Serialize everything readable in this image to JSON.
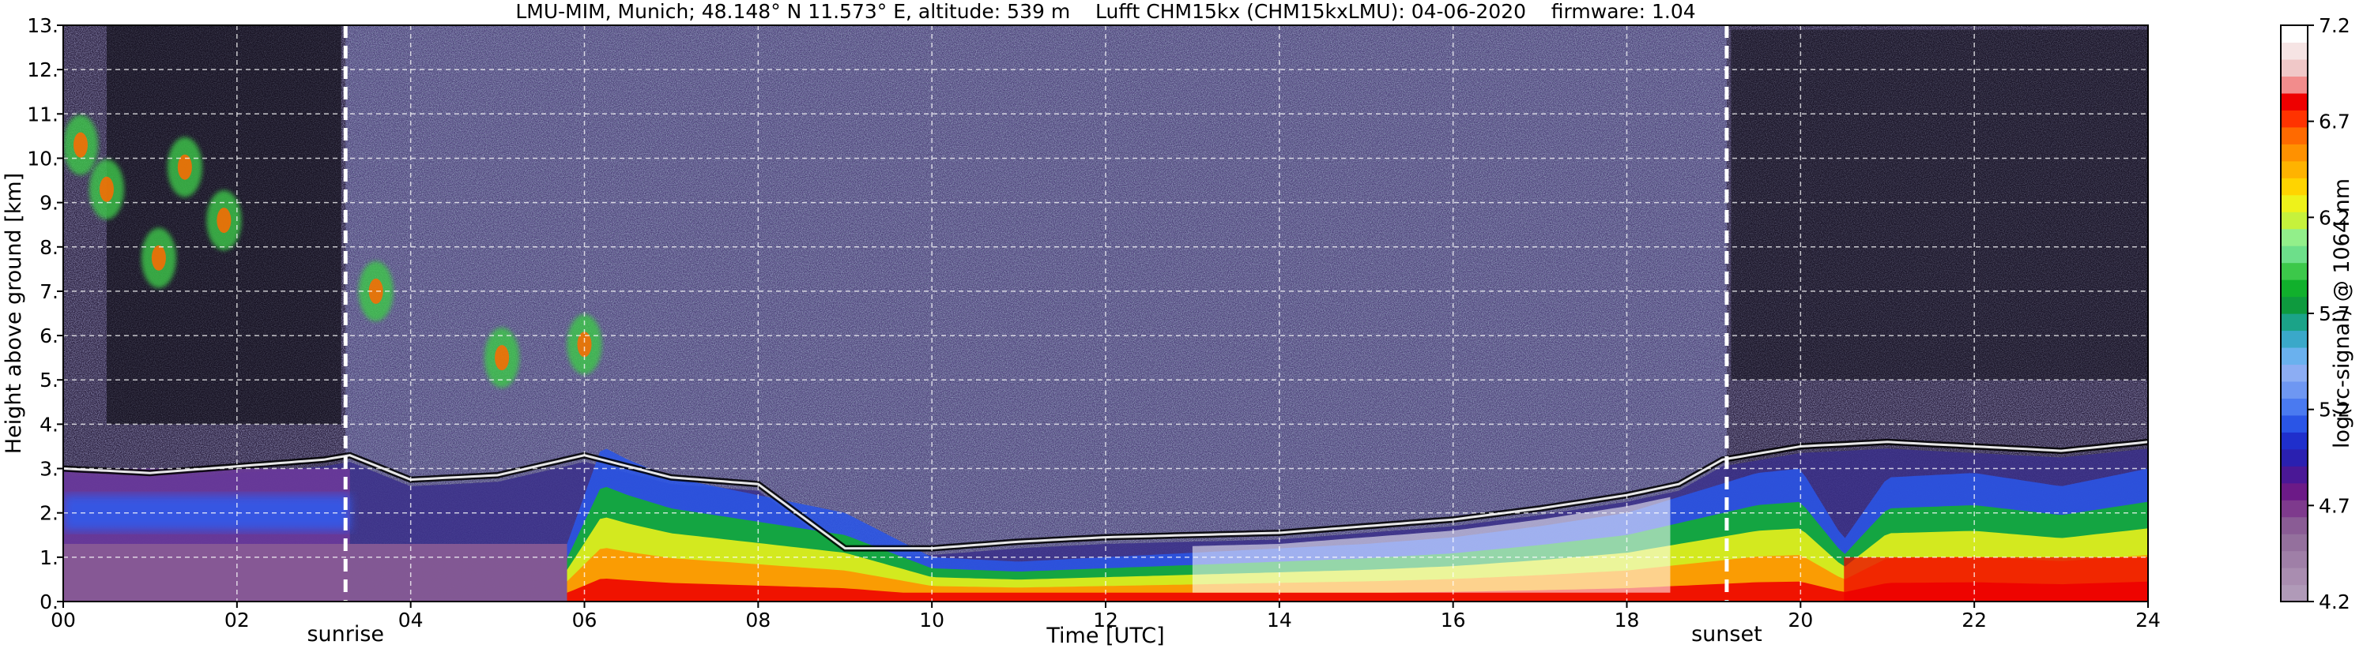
{
  "chart_data": {
    "type": "heatmap",
    "title": "LMU-MIM, Munich; 48.148° N 11.573° E, altitude: 539 m    Lufft CHM15kx (CHM15kxLMU): 04-06-2020    firmware: 1.04",
    "xlabel": "Time [UTC]",
    "ylabel": "Height above ground [km]",
    "xlim": [
      0,
      24
    ],
    "ylim": [
      0,
      13
    ],
    "x_ticks": [
      "00",
      "02",
      "04",
      "06",
      "08",
      "10",
      "12",
      "14",
      "16",
      "18",
      "20",
      "22",
      "24"
    ],
    "y_ticks": [
      "0.",
      "1.",
      "2.",
      "3.",
      "4.",
      "5.",
      "6.",
      "7.",
      "8.",
      "9.",
      "10.",
      "11.",
      "12.",
      "13."
    ],
    "grid": true,
    "events": [
      {
        "label": "sunrise",
        "time": 3.25
      },
      {
        "label": "sunset",
        "time": 19.15
      }
    ],
    "colorbar": {
      "label": "log(rc-signal) @ 1064 nm",
      "min": 4.2,
      "max": 7.2,
      "ticks": [
        "4.2",
        "4.7",
        "5.2",
        "5.7",
        "6.2",
        "6.7",
        "7.2"
      ],
      "colors": [
        "#b09ab8",
        "#a98db0",
        "#9f7fa7",
        "#94709d",
        "#8a5c95",
        "#7e3a8d",
        "#6c1a87",
        "#4a1896",
        "#2a20b0",
        "#1f2fcc",
        "#2a55e6",
        "#4a7af0",
        "#6e97f2",
        "#8cadf3",
        "#6ab1ee",
        "#3aa8c9",
        "#1ba388",
        "#0e9a3e",
        "#11b02c",
        "#3cc84a",
        "#6ddf8a",
        "#92ef8a",
        "#c6f23c",
        "#eef21a",
        "#ffd400",
        "#ffb300",
        "#ff9100",
        "#ff6a00",
        "#ff3300",
        "#ee0000",
        "#f28c8c",
        "#f0c8c8",
        "#f6e4e4",
        "#ffffff"
      ]
    },
    "layers": [
      {
        "name": "boundary_layer_top_km",
        "x": [
          0,
          1,
          2,
          3,
          3.3,
          4,
          5,
          6,
          7,
          8,
          9,
          10,
          11,
          12,
          13,
          14,
          15,
          16,
          17,
          18,
          18.6,
          19.1,
          20,
          21,
          22,
          23,
          24
        ],
        "y": [
          3.0,
          2.9,
          3.05,
          3.2,
          3.3,
          2.75,
          2.85,
          3.3,
          2.8,
          2.65,
          1.2,
          1.2,
          1.35,
          1.45,
          1.5,
          1.55,
          1.7,
          1.85,
          2.1,
          2.4,
          2.65,
          3.2,
          3.5,
          3.6,
          3.5,
          3.4,
          3.6
        ]
      },
      {
        "name": "aerosol_strong_top_km",
        "x": [
          0,
          1,
          2,
          3,
          4,
          5,
          5.8,
          6.2,
          6.5,
          7,
          7.5,
          8,
          8.5,
          9,
          10,
          11,
          12,
          13,
          14,
          15,
          16,
          17,
          18,
          19,
          19.5,
          20,
          20.5,
          21,
          22,
          23,
          24
        ],
        "y": [
          2.0,
          2.05,
          1.9,
          1.6,
          1.2,
          1.1,
          1.3,
          3.5,
          3.2,
          2.8,
          2.6,
          2.4,
          2.2,
          2.0,
          1.0,
          0.9,
          1.0,
          1.1,
          1.2,
          1.3,
          1.45,
          1.7,
          2.0,
          2.6,
          2.9,
          3.0,
          1.4,
          2.8,
          2.9,
          2.6,
          3.0
        ]
      },
      {
        "name": "cloud_patches_km",
        "x": [
          0.2,
          0.5,
          1.1,
          1.4,
          1.85,
          3.6,
          5.05,
          6.0
        ],
        "y": [
          10.3,
          9.3,
          7.75,
          9.8,
          8.6,
          7.0,
          5.5,
          5.8
        ]
      }
    ]
  }
}
